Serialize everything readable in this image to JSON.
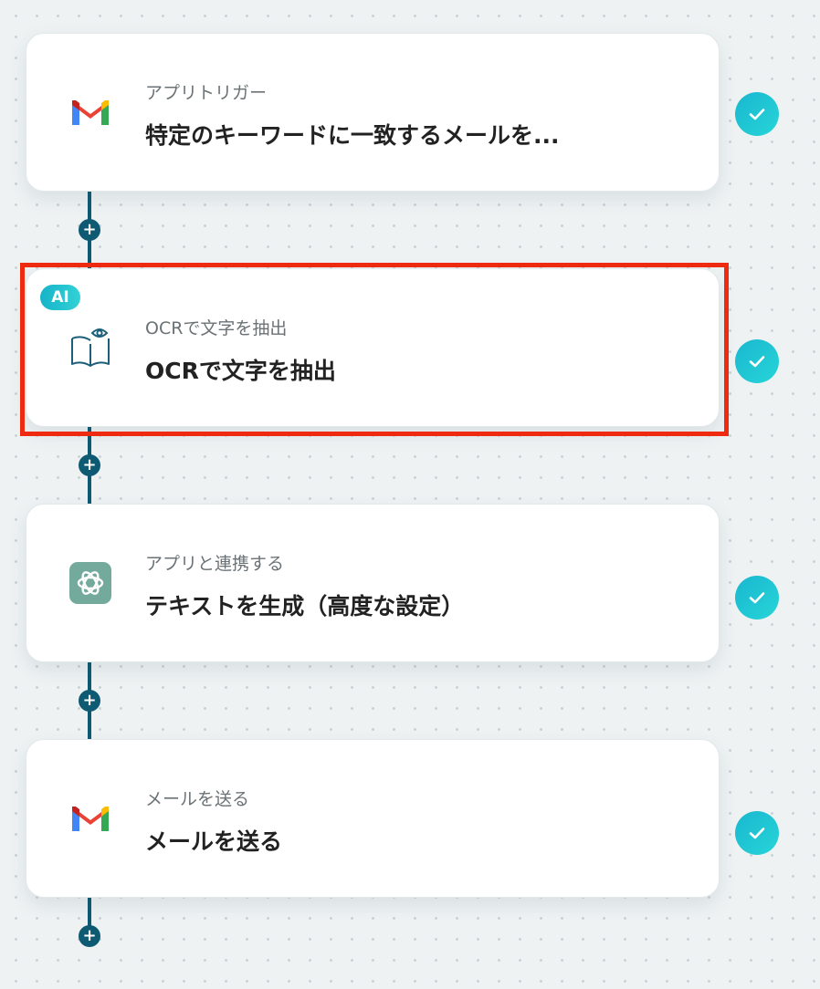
{
  "steps": [
    {
      "subtitle": "アプリトリガー",
      "title": "特定のキーワードに一致するメールを...",
      "icon": "gmail-icon"
    },
    {
      "badge": "AI",
      "subtitle": "OCRで文字を抽出",
      "title": "OCRで文字を抽出",
      "icon": "ocr-book-icon"
    },
    {
      "subtitle": "アプリと連携する",
      "title": "テキストを生成（高度な設定）",
      "icon": "chatgpt-icon"
    },
    {
      "subtitle": "メールを送る",
      "title": "メールを送る",
      "icon": "gmail-icon"
    }
  ],
  "add_step_symbol": "+",
  "colors": {
    "connector": "#0f5a73",
    "check_gradient_start": "#19b7cf",
    "check_gradient_end": "#27d5d8",
    "highlight": "#ee2a10",
    "chatgpt_bg": "#74aa9c"
  }
}
